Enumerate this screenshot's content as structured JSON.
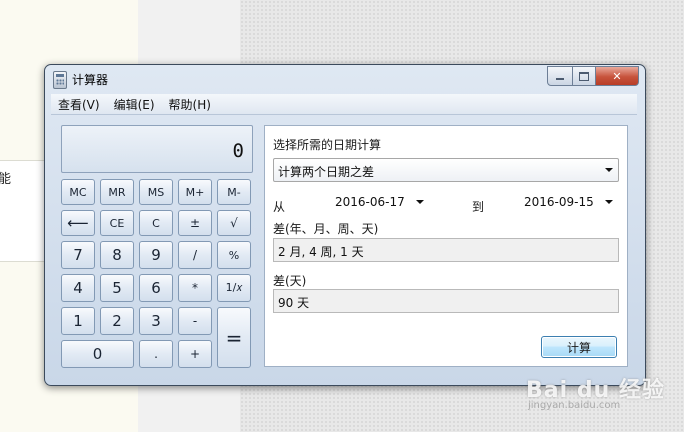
{
  "backdrop": {
    "left_text": "能"
  },
  "watermark": {
    "text": "Bai du 经验",
    "url": "jingyan.baidu.com"
  },
  "window": {
    "title": "计算器"
  },
  "menu": [
    "查看(V)",
    "编辑(E)",
    "帮助(H)"
  ],
  "display": {
    "value": "0"
  },
  "keys": {
    "mc": "MC",
    "mr": "MR",
    "ms": "MS",
    "mplus": "M+",
    "mminus": "M-",
    "back": "⟵",
    "ce": "CE",
    "c": "C",
    "plusminus": "±",
    "sqrt": "√",
    "k7": "7",
    "k8": "8",
    "k9": "9",
    "div": "/",
    "pct": "%",
    "k4": "4",
    "k5": "5",
    "k6": "6",
    "mul": "*",
    "recip": "1/𝑥",
    "k1": "1",
    "k2": "2",
    "k3": "3",
    "sub": "-",
    "eq": "=",
    "k0": "0",
    "dot": ".",
    "add": "+"
  },
  "date_calc": {
    "heading": "选择所需的日期计算",
    "mode": "计算两个日期之差",
    "from_label": "从",
    "from_date": "2016-06-17",
    "to_label": "到",
    "to_date": "2016-09-15",
    "diff_label": "差(年、月、周、天)",
    "diff_value": "2 月, 4 周, 1 天",
    "days_label": "差(天)",
    "days_value": "90 天",
    "calc_button": "计算"
  }
}
